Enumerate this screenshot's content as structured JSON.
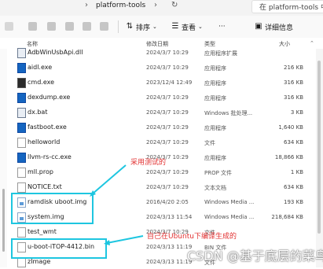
{
  "window": {
    "breadcrumb": [
      "platform-tools"
    ],
    "search_text": "在 platform-tools 中搜"
  },
  "toolbar": {
    "sort_label": "排序",
    "view_label": "查看",
    "more_label": "···",
    "details_label": "详细信息"
  },
  "columns": {
    "name": "名称",
    "date": "修改日期",
    "type": "类型",
    "size": "大小"
  },
  "files": [
    {
      "name": "AdbWinUsbApi.dll",
      "date": "2024/3/7 10:29",
      "type": "应用程序扩展",
      "size": "",
      "icon": "gear"
    },
    {
      "name": "aidl.exe",
      "date": "2024/3/7 10:29",
      "type": "应用程序",
      "size": "216 KB",
      "icon": "blue"
    },
    {
      "name": "cmd.exe",
      "date": "2023/12/4 12:49",
      "type": "应用程序",
      "size": "316 KB",
      "icon": "dark"
    },
    {
      "name": "dexdump.exe",
      "date": "2024/3/7 10:29",
      "type": "应用程序",
      "size": "316 KB",
      "icon": "blue"
    },
    {
      "name": "dx.bat",
      "date": "2024/3/7 10:29",
      "type": "Windows 批处理...",
      "size": "3 KB",
      "icon": "gear"
    },
    {
      "name": "fastboot.exe",
      "date": "2024/3/7 10:29",
      "type": "应用程序",
      "size": "1,640 KB",
      "icon": "blue"
    },
    {
      "name": "helloworld",
      "date": "2024/3/7 10:29",
      "type": "文件",
      "size": "634 KB",
      "icon": "doc"
    },
    {
      "name": "llvm-rs-cc.exe",
      "date": "2024/3/7 10:29",
      "type": "应用程序",
      "size": "18,866 KB",
      "icon": "blue"
    },
    {
      "name": "mll.prop",
      "date": "2024/3/7 10:29",
      "type": "PROP 文件",
      "size": "1 KB",
      "icon": "doc"
    },
    {
      "name": "NOTICE.txt",
      "date": "2024/3/7 10:29",
      "type": "文本文档",
      "size": "634 KB",
      "icon": "doc"
    },
    {
      "name": "ramdisk uboot.img",
      "date": "2016/4/20 2:05",
      "type": "Windows Media ...",
      "size": "193 KB",
      "icon": "img"
    },
    {
      "name": "system.img",
      "date": "2024/3/13 11:54",
      "type": "Windows Media ...",
      "size": "218,684 KB",
      "icon": "img"
    },
    {
      "name": "test_wmt",
      "date": "2024/3/7 10:29",
      "type": "文件",
      "size": "",
      "icon": "doc"
    },
    {
      "name": "u-boot-iTOP-4412.bin",
      "date": "2024/3/13 11:19",
      "type": "BIN 文件",
      "size": "",
      "icon": "doc"
    },
    {
      "name": "zImage",
      "date": "2024/3/13 11:19",
      "type": "文件",
      "size": "",
      "icon": "doc"
    }
  ],
  "annotations": {
    "official": "采用测试的",
    "compiled": "自己在Ubuntu下编译生成的"
  },
  "watermark": "CSDN @基于底层的菜鸟",
  "colors": {
    "highlight_box": "#1ec6e0",
    "annotation_text": "#e23131"
  }
}
